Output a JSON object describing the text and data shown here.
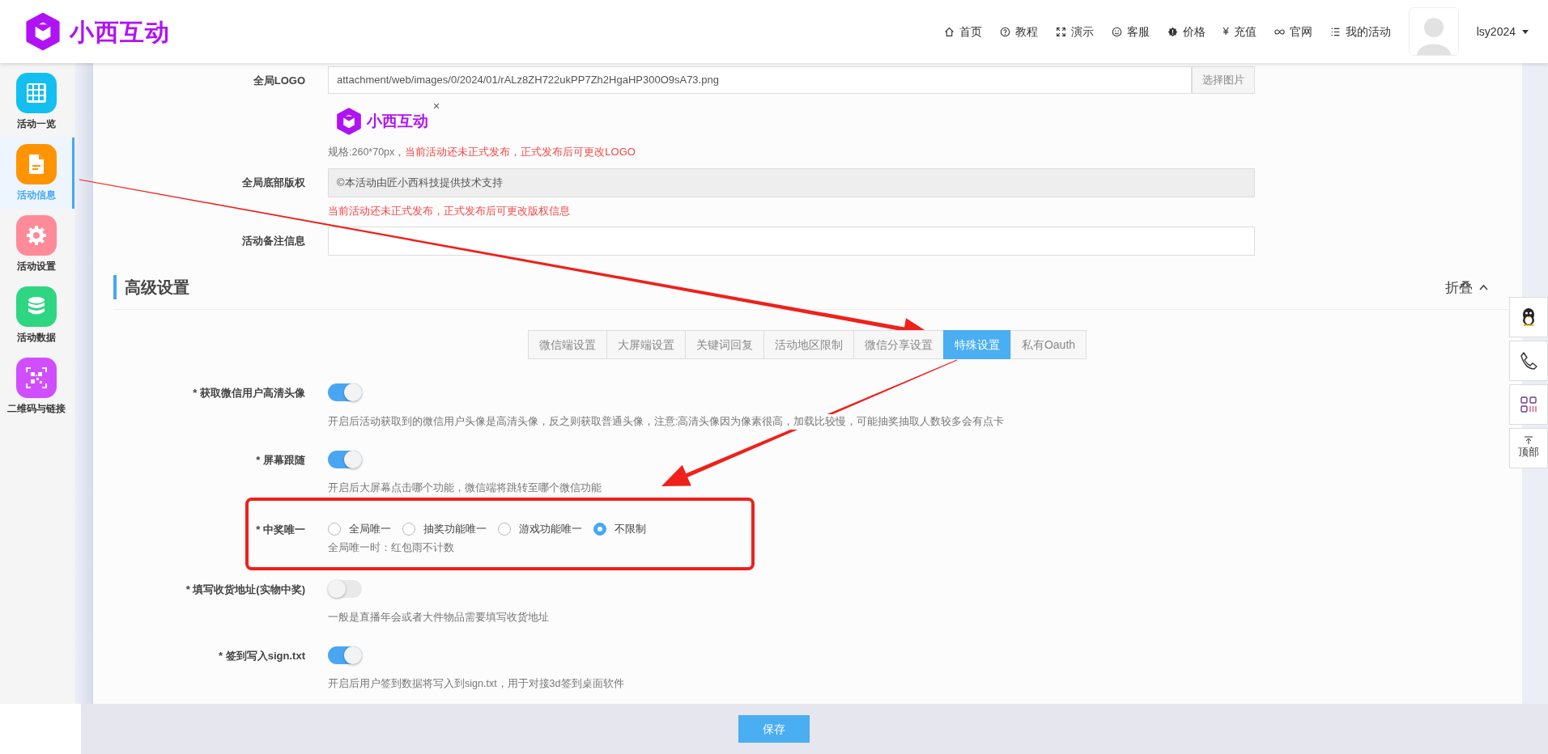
{
  "header": {
    "logo_text": "小西互动",
    "nav": [
      {
        "label": "首页"
      },
      {
        "label": "教程"
      },
      {
        "label": "演示"
      },
      {
        "label": "客服"
      },
      {
        "label": "价格"
      },
      {
        "label": "充值",
        "glyph": "¥"
      },
      {
        "label": "官网"
      },
      {
        "label": "我的活动"
      }
    ],
    "user": "lsy2024"
  },
  "sidebar": {
    "items": [
      {
        "label": "活动一览",
        "selected": false,
        "color": "#13bff0"
      },
      {
        "label": "活动信息",
        "selected": true,
        "color": "#ff9400"
      },
      {
        "label": "活动设置",
        "selected": false,
        "color": "#ff8a98"
      },
      {
        "label": "活动数据",
        "selected": false,
        "color": "#2fd682"
      },
      {
        "label": "二维码与链接",
        "selected": false,
        "color": "#d04eff"
      }
    ]
  },
  "basic_fields": [
    {
      "label": "全局LOGO",
      "kind": "image",
      "value": "attachment/web/images/0/2024/01/rALz8ZH722ukPP7Zh2HgaHP300O9sA73.png",
      "button": "选择图片",
      "preview_text": "小西互动",
      "remove": "×",
      "hint": "规格:260*70px，",
      "warning": "当前活动还未正式发布，正式发布后可更改LOGO"
    },
    {
      "label": "全局底部版权",
      "kind": "text",
      "value": "©本活动由匠小西科技提供技术支持",
      "disabled": true,
      "warning": "当前活动还未正式发布，正式发布后可更改版权信息"
    },
    {
      "label": "活动备注信息",
      "kind": "text",
      "disabled": false
    }
  ],
  "section": {
    "title": "高级设置",
    "collapse": "折叠"
  },
  "tabs": [
    {
      "label": "微信端设置",
      "selected": false
    },
    {
      "label": "大屏端设置",
      "selected": false
    },
    {
      "label": "关键词回复",
      "selected": false
    },
    {
      "label": "活动地区限制",
      "selected": false
    },
    {
      "label": "微信分享设置",
      "selected": false
    },
    {
      "label": "特殊设置",
      "selected": true
    },
    {
      "label": "私有Oauth",
      "selected": false
    }
  ],
  "settings": [
    {
      "label": "* 获取微信用户高清头像",
      "kind": "switch",
      "on": true,
      "hint": "开启后活动获取到的微信用户头像是高清头像，反之则获取普通头像，注意:高清头像因为像素很高，加载比较慢，可能抽奖抽取人数较多会有点卡"
    },
    {
      "label": "* 屏幕跟随",
      "kind": "switch",
      "on": true,
      "hint": "开启后大屏幕点击哪个功能，微信端将跳转至哪个微信功能"
    },
    {
      "label": "* 中奖唯一",
      "kind": "radio",
      "highlighted": true,
      "options": [
        {
          "label": "全局唯一",
          "selected": false
        },
        {
          "label": "抽奖功能唯一",
          "selected": false
        },
        {
          "label": "游戏功能唯一",
          "selected": false
        },
        {
          "label": "不限制",
          "selected": true
        }
      ],
      "hint": "全局唯一时：红包雨不计数"
    },
    {
      "label": "* 填写收货地址(实物中奖)",
      "kind": "switch",
      "on": false,
      "hint": "一般是直播年会或者大件物品需要填写收货地址"
    },
    {
      "label": "* 签到写入sign.txt",
      "kind": "switch",
      "on": true,
      "hint": "开启后用户签到数据将写入到sign.txt，用于对接3d签到桌面软件"
    }
  ],
  "save_button": "保存",
  "side_tools": [
    {
      "kind": "penguin"
    },
    {
      "kind": "phone"
    },
    {
      "kind": "apps"
    },
    {
      "kind": "top",
      "label": "顶部"
    }
  ],
  "annotations": [
    {
      "kind": "arrow"
    },
    {
      "kind": "arrow"
    }
  ]
}
